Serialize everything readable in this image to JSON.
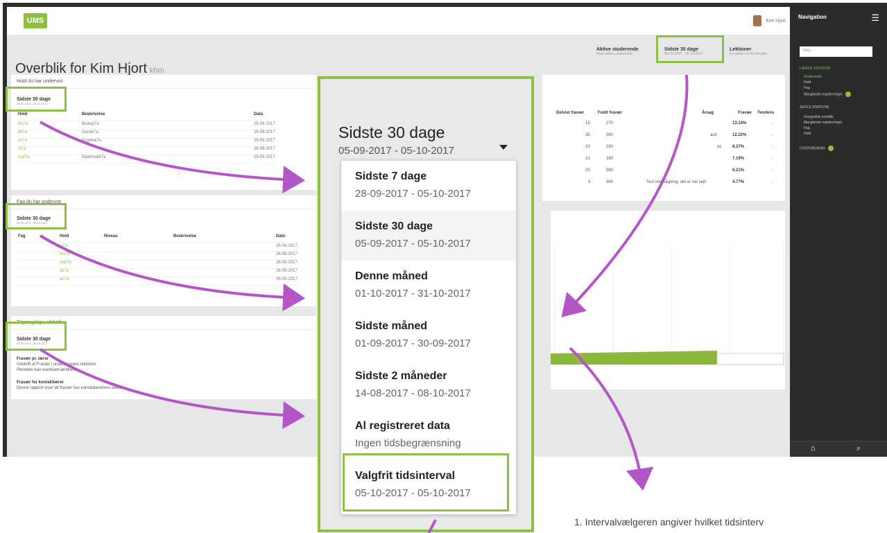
{
  "app": {
    "logo": "UMS",
    "user_name": "Kim Hjort",
    "page_title": "Overblik for Kim Hjort",
    "page_initials": "khm"
  },
  "filters": [
    {
      "title": "Aktive studerende",
      "sub": "Viser aktive studerende"
    },
    {
      "title": "Sidste 30 dage",
      "sub": "05-09-2017 - 05-10-2017"
    },
    {
      "title": "Lektioner",
      "sub": "En lektion er 45 minutter"
    }
  ],
  "panels": {
    "hold": {
      "title": "Hold du har undervist",
      "selector": {
        "title": "Sidste 30 dage",
        "sub": "05-09-2017 - 05-10-2017"
      },
      "headers": [
        "Hold",
        "Beskrivelse",
        "Dato"
      ],
      "rows": [
        [
          "bio7a",
          "Biologi7a",
          "26-09-2017"
        ],
        [
          "dk7a",
          "Dansk7a",
          "26-09-2017"
        ],
        [
          "en7a",
          "Engelsk7a",
          "26-09-2017"
        ],
        [
          "id7a",
          "",
          "26-09-2017"
        ],
        [
          "mat7a",
          "Matematik7a",
          "26-09-2017"
        ]
      ]
    },
    "fag": {
      "title": "Fag du har undervist",
      "selector": {
        "title": "Sidste 30 dage",
        "sub": "05-09-2017 - 05-10-2017"
      },
      "headers": [
        "Fag",
        "Hold",
        "Niveau",
        "Beskrivelse",
        "Dato"
      ],
      "rows": [
        [
          "",
          "id7a",
          "",
          "",
          "26-09-2017"
        ],
        [
          "",
          "bio7a",
          "",
          "",
          "26-09-2017"
        ],
        [
          "",
          "mat7a",
          "",
          "",
          "26-09-2017"
        ],
        [
          "",
          "dk7a",
          "",
          "",
          "26-09-2017"
        ],
        [
          "",
          "en7a",
          "",
          "",
          "26-09-2017"
        ]
      ]
    },
    "udskrifter": {
      "title": "Tilgængelige udskrifter",
      "selector": {
        "title": "Sidste 30 dage",
        "sub": "05-09-2017 - 05-10-2017"
      },
      "items": [
        {
          "title": "Fravær pr. lærer",
          "line1": "Udskrift af Fravær i underviserens lektioner",
          "line2": "Perioden kan eventuelt ændres"
        },
        {
          "title": "Fravær for kontaktlærer",
          "line1": "Denne rapport viser alt fravær hos kontaktlærerens elever",
          "line2": ""
        }
      ]
    }
  },
  "absence_table": {
    "headers": [
      "Delvist fravær",
      "Fuldt fravær",
      "Årsag",
      "Fravær",
      "Tendens"
    ],
    "rows": [
      {
        "delvist": "15",
        "fuldt": "270",
        "aarsag": "",
        "fravaer": "13.14%"
      },
      {
        "delvist": "35",
        "fuldt": "360",
        "aarsag": "asd",
        "fravaer": "12.22%"
      },
      {
        "delvist": "10",
        "fuldt": "180",
        "aarsag": "as",
        "fravaer": "8.37%"
      },
      {
        "delvist": "10",
        "fuldt": "180",
        "aarsag": "",
        "fravaer": "7.19%"
      },
      {
        "delvist": "25",
        "fuldt": "360",
        "aarsag": "",
        "fravaer": "6.21%"
      },
      {
        "delvist": "5",
        "fuldt": "360",
        "aarsag": "Test overvågning, det er net sejt!",
        "fravaer": "4.77%"
      }
    ]
  },
  "nav": {
    "title": "Navigation",
    "search_placeholder": "Søg...",
    "section1": "LÆRER STATISTIK",
    "items1": [
      "Studerende",
      "Hold",
      "Fag",
      "Manglende registreringer"
    ],
    "section2": "SKOLE STATISTIK",
    "items2": [
      "Geografisk overblik",
      "Manglende registreringer",
      "Fag",
      "Hold"
    ],
    "section3": "OVERVÅGNING"
  },
  "dropdown": {
    "title": "Sidste 30 dage",
    "range": "05-09-2017 - 05-10-2017",
    "options": [
      {
        "label": "Sidste 7 dage",
        "range": "28-09-2017 - 05-10-2017"
      },
      {
        "label": "Sidste 30 dage",
        "range": "05-09-2017 - 05-10-2017"
      },
      {
        "label": "Denne måned",
        "range": "01-10-2017 - 31-10-2017"
      },
      {
        "label": "Sidste måned",
        "range": "01-09-2017 - 30-09-2017"
      },
      {
        "label": "Sidste 2 måneder",
        "range": "14-08-2017 - 08-10-2017"
      },
      {
        "label": "Al registreret data",
        "range": "Ingen tidsbegrænsning"
      },
      {
        "label": "Valgfrit tidsinterval",
        "range": "05-10-2017 - 05-10-2017"
      }
    ]
  },
  "caption": "1. Intervalvælgeren angiver hvilket tidsinterv",
  "colors": {
    "accent": "#8cc03f",
    "arrow": "#b455c8",
    "nav_bg": "#2b2b2b"
  }
}
